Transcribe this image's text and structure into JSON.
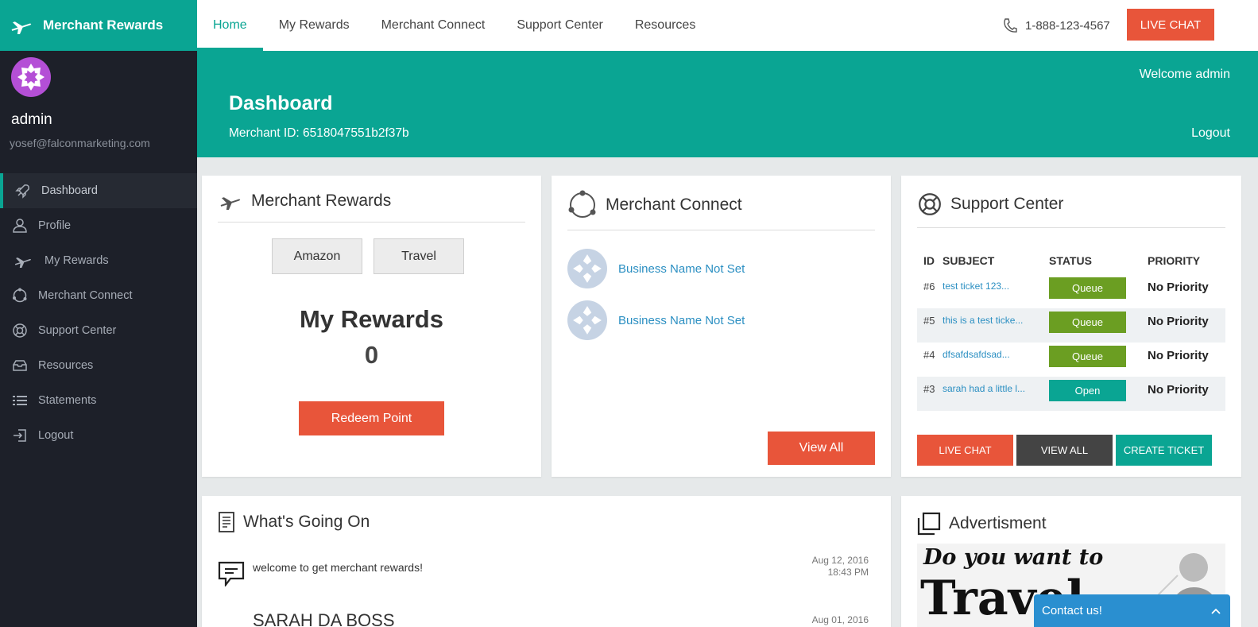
{
  "brand": {
    "name": "Merchant Rewards"
  },
  "user": {
    "name": "admin",
    "email": "yosef@falconmarketing.com"
  },
  "sidebar": {
    "items": [
      {
        "label": "Dashboard",
        "icon": "rocket-icon",
        "active": true
      },
      {
        "label": "Profile",
        "icon": "user-icon"
      },
      {
        "label": "My Rewards",
        "icon": "plane-icon"
      },
      {
        "label": "Merchant Connect",
        "icon": "connect-icon"
      },
      {
        "label": "Support Center",
        "icon": "lifebuoy-icon"
      },
      {
        "label": "Resources",
        "icon": "inbox-icon"
      },
      {
        "label": "Statements",
        "icon": "list-icon"
      },
      {
        "label": "Logout",
        "icon": "logout-icon"
      }
    ]
  },
  "topnav": {
    "tabs": [
      "Home",
      "My Rewards",
      "Merchant Connect",
      "Support Center",
      "Resources"
    ],
    "active_tab": "Home",
    "phone": "1-888-123-4567",
    "live_chat": "LIVE CHAT"
  },
  "header": {
    "title": "Dashboard",
    "merchant_id": "Merchant ID: 6518047551b2f37b",
    "welcome": "Welcome admin",
    "logout": "Logout"
  },
  "rewards_card": {
    "title": "Merchant Rewards",
    "buttons": [
      "Amazon",
      "Travel"
    ],
    "my_rewards_label": "My Rewards",
    "my_rewards_value": "0",
    "redeem": "Redeem Point"
  },
  "connect_card": {
    "title": "Merchant Connect",
    "items": [
      "Business Name Not Set",
      "Business Name Not Set"
    ],
    "view_all": "View All"
  },
  "support_card": {
    "title": "Support Center",
    "columns": [
      "ID",
      "SUBJECT",
      "STATUS",
      "PRIORITY"
    ],
    "rows": [
      {
        "id": "#6",
        "subject": "test ticket 123...",
        "status": "Queue",
        "priority": "No Priority"
      },
      {
        "id": "#5",
        "subject": "this is a test ticke...",
        "status": "Queue",
        "priority": "No Priority"
      },
      {
        "id": "#4",
        "subject": "dfsafdsafdsad...",
        "status": "Queue",
        "priority": "No Priority"
      },
      {
        "id": "#3",
        "subject": "sarah had a little l...",
        "status": "Open",
        "priority": "No Priority"
      }
    ],
    "buttons": {
      "live_chat": "LIVE CHAT",
      "view_all": "VIEW ALL",
      "create_ticket": "CREATE TICKET"
    }
  },
  "news_card": {
    "title": "What's Going On",
    "items": [
      {
        "text": "welcome to get merchant rewards!",
        "date": "Aug 12, 2016",
        "time": "18:43 PM"
      },
      {
        "text": "SARAH DA BOSS",
        "date": "Aug 01, 2016",
        "time": ""
      }
    ]
  },
  "ad_card": {
    "title": "Advertisment",
    "ad_line1": "Do you want to",
    "ad_line2": "Travel"
  },
  "contact": {
    "label": "Contact us!"
  },
  "colors": {
    "accent": "#0aa593",
    "orange": "#e8553a",
    "sidebar": "#1d2029",
    "queue": "#6b9e22"
  }
}
